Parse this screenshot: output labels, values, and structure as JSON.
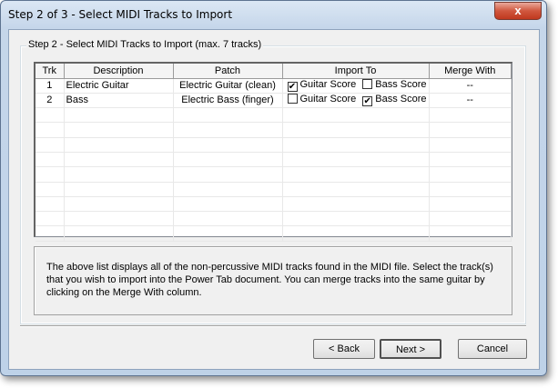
{
  "window": {
    "title": "Step 2 of 3 - Select MIDI Tracks to Import",
    "close": "x"
  },
  "group": {
    "label": "Step 2 - Select MIDI Tracks to Import (max. 7 tracks)"
  },
  "table": {
    "headers": [
      "Trk",
      "Description",
      "Patch",
      "Import To",
      "Merge With"
    ],
    "rows": [
      {
        "trk": "1",
        "description": "Electric Guitar",
        "patch": "Electric Guitar (clean)",
        "guitar_label": "Guitar Score",
        "guitar_checked": true,
        "bass_label": "Bass Score",
        "bass_checked": false,
        "merge": "--"
      },
      {
        "trk": "2",
        "description": "Bass",
        "patch": "Electric Bass (finger)",
        "guitar_label": "Guitar Score",
        "guitar_checked": false,
        "bass_label": "Bass Score",
        "bass_checked": true,
        "merge": "--"
      }
    ]
  },
  "note": "The above list displays all of the non-percussive MIDI tracks found in the MIDI file.  Select the track(s) that you wish to import into the Power Tab document.  You can merge tracks into the same guitar by clicking on the Merge With column.",
  "buttons": {
    "back": "< Back",
    "next": "Next >",
    "cancel": "Cancel"
  }
}
